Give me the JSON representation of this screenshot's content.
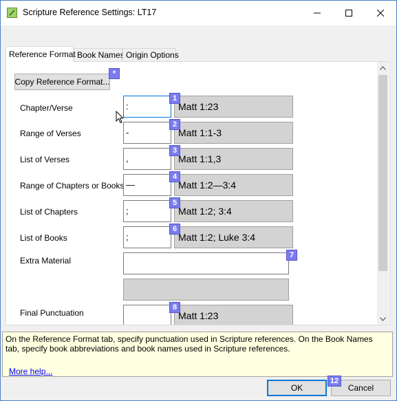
{
  "window": {
    "title": "Scripture Reference Settings: LT17",
    "icon": "document-pen-icon",
    "controls": {
      "minimize": "minimize-icon",
      "maximize": "maximize-icon",
      "close": "close-icon"
    }
  },
  "tabs": [
    {
      "label": "Reference Format",
      "active": true
    },
    {
      "label": "Book Names",
      "active": false
    },
    {
      "label": "Origin Options",
      "active": false
    }
  ],
  "copy_button": {
    "label": "Copy Reference Format...",
    "badge": "*"
  },
  "rows": [
    {
      "label": "Chapter/Verse",
      "value": ":",
      "preview": "Matt 1:23",
      "badge": "1"
    },
    {
      "label": "Range of Verses",
      "value": "-",
      "preview": "Matt 1:1-3",
      "badge": "2"
    },
    {
      "label": "List of Verses",
      "value": ",",
      "preview": "Matt 1:1,3",
      "badge": "3"
    },
    {
      "label": "Range of Chapters or Books",
      "value": "—",
      "preview": "Matt 1:2—3:4",
      "badge": "4"
    },
    {
      "label": "List of Chapters",
      "value": ";",
      "preview": "Matt 1:2; 3:4",
      "badge": "5"
    },
    {
      "label": "List of Books",
      "value": ";",
      "preview": "Matt 1:2; Luke 3:4",
      "badge": "6"
    }
  ],
  "extra_material": {
    "label": "Extra Material",
    "value": "",
    "preview": "",
    "badge": "7"
  },
  "final_punctuation": {
    "label": "Final Punctuation",
    "value": "",
    "preview": "Matt 1:23",
    "badge": "8"
  },
  "help": {
    "text": "On the Reference Format tab, specify punctuation used in Scripture references. On the Book Names tab, specify book abbreviations and book names used in Scripture references.",
    "more_link": "More help..."
  },
  "buttons": {
    "ok": "OK",
    "cancel": "Cancel",
    "ok_badge": "12"
  },
  "colors": {
    "badge": "#7b7bee",
    "help_background": "#ffffe1",
    "preview_background": "#d3d3d3",
    "focus_border": "#0078d7"
  }
}
